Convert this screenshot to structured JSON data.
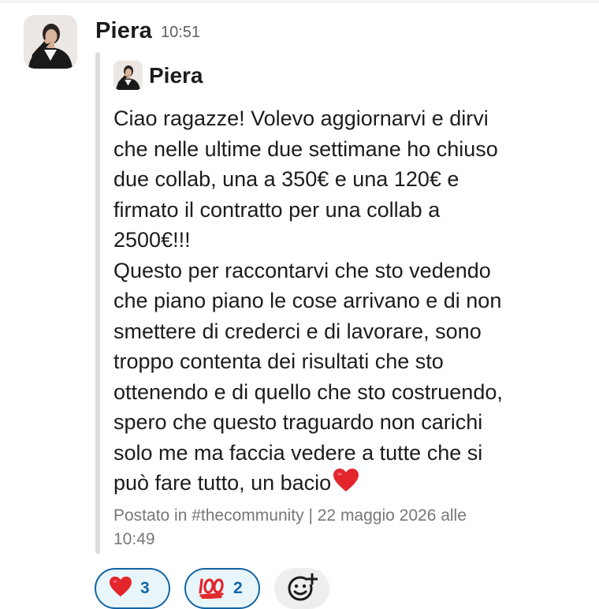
{
  "post": {
    "author": "Piera",
    "time": "10:51",
    "avatar_icon": "profile-photo-woman"
  },
  "quoted": {
    "author": "Piera",
    "message_lines": [
      "Ciao ragazze! Volevo aggiornarvi e dirvi",
      "che nelle ultime due settimane ho chiuso",
      "due collab, una a 350€ e una 120€ e",
      "firmato il contratto per una collab a",
      "2500€!!!",
      "Questo per raccontarvi che sto vedendo",
      "che piano piano le cose arrivano e di non",
      "smettere di crederci e di lavorare, sono",
      "troppo contenta dei risultati che sto",
      "ottenendo e di quello che sto costruendo,",
      "spero che questo traguardo non carichi",
      "solo me ma faccia vedere a tutte che si",
      "può fare tutto, un bacio"
    ],
    "trailing_emoji": "red-heart",
    "meta_lines": [
      "Postato in #thecommunity | 22 maggio 2026 alle",
      "10:49"
    ]
  },
  "reactions": [
    {
      "emoji": "red-heart",
      "count": "3"
    },
    {
      "emoji": "hundred-points",
      "count": "2"
    }
  ],
  "add_reaction": {
    "icon": "add-emoji-icon"
  },
  "colors": {
    "text": "#1d1c1d",
    "muted": "#616061",
    "reaction_border": "#1264a3",
    "reaction_bg": "#e8f5fa",
    "quote_bar": "#dddddd",
    "heart": "#e3262c"
  }
}
